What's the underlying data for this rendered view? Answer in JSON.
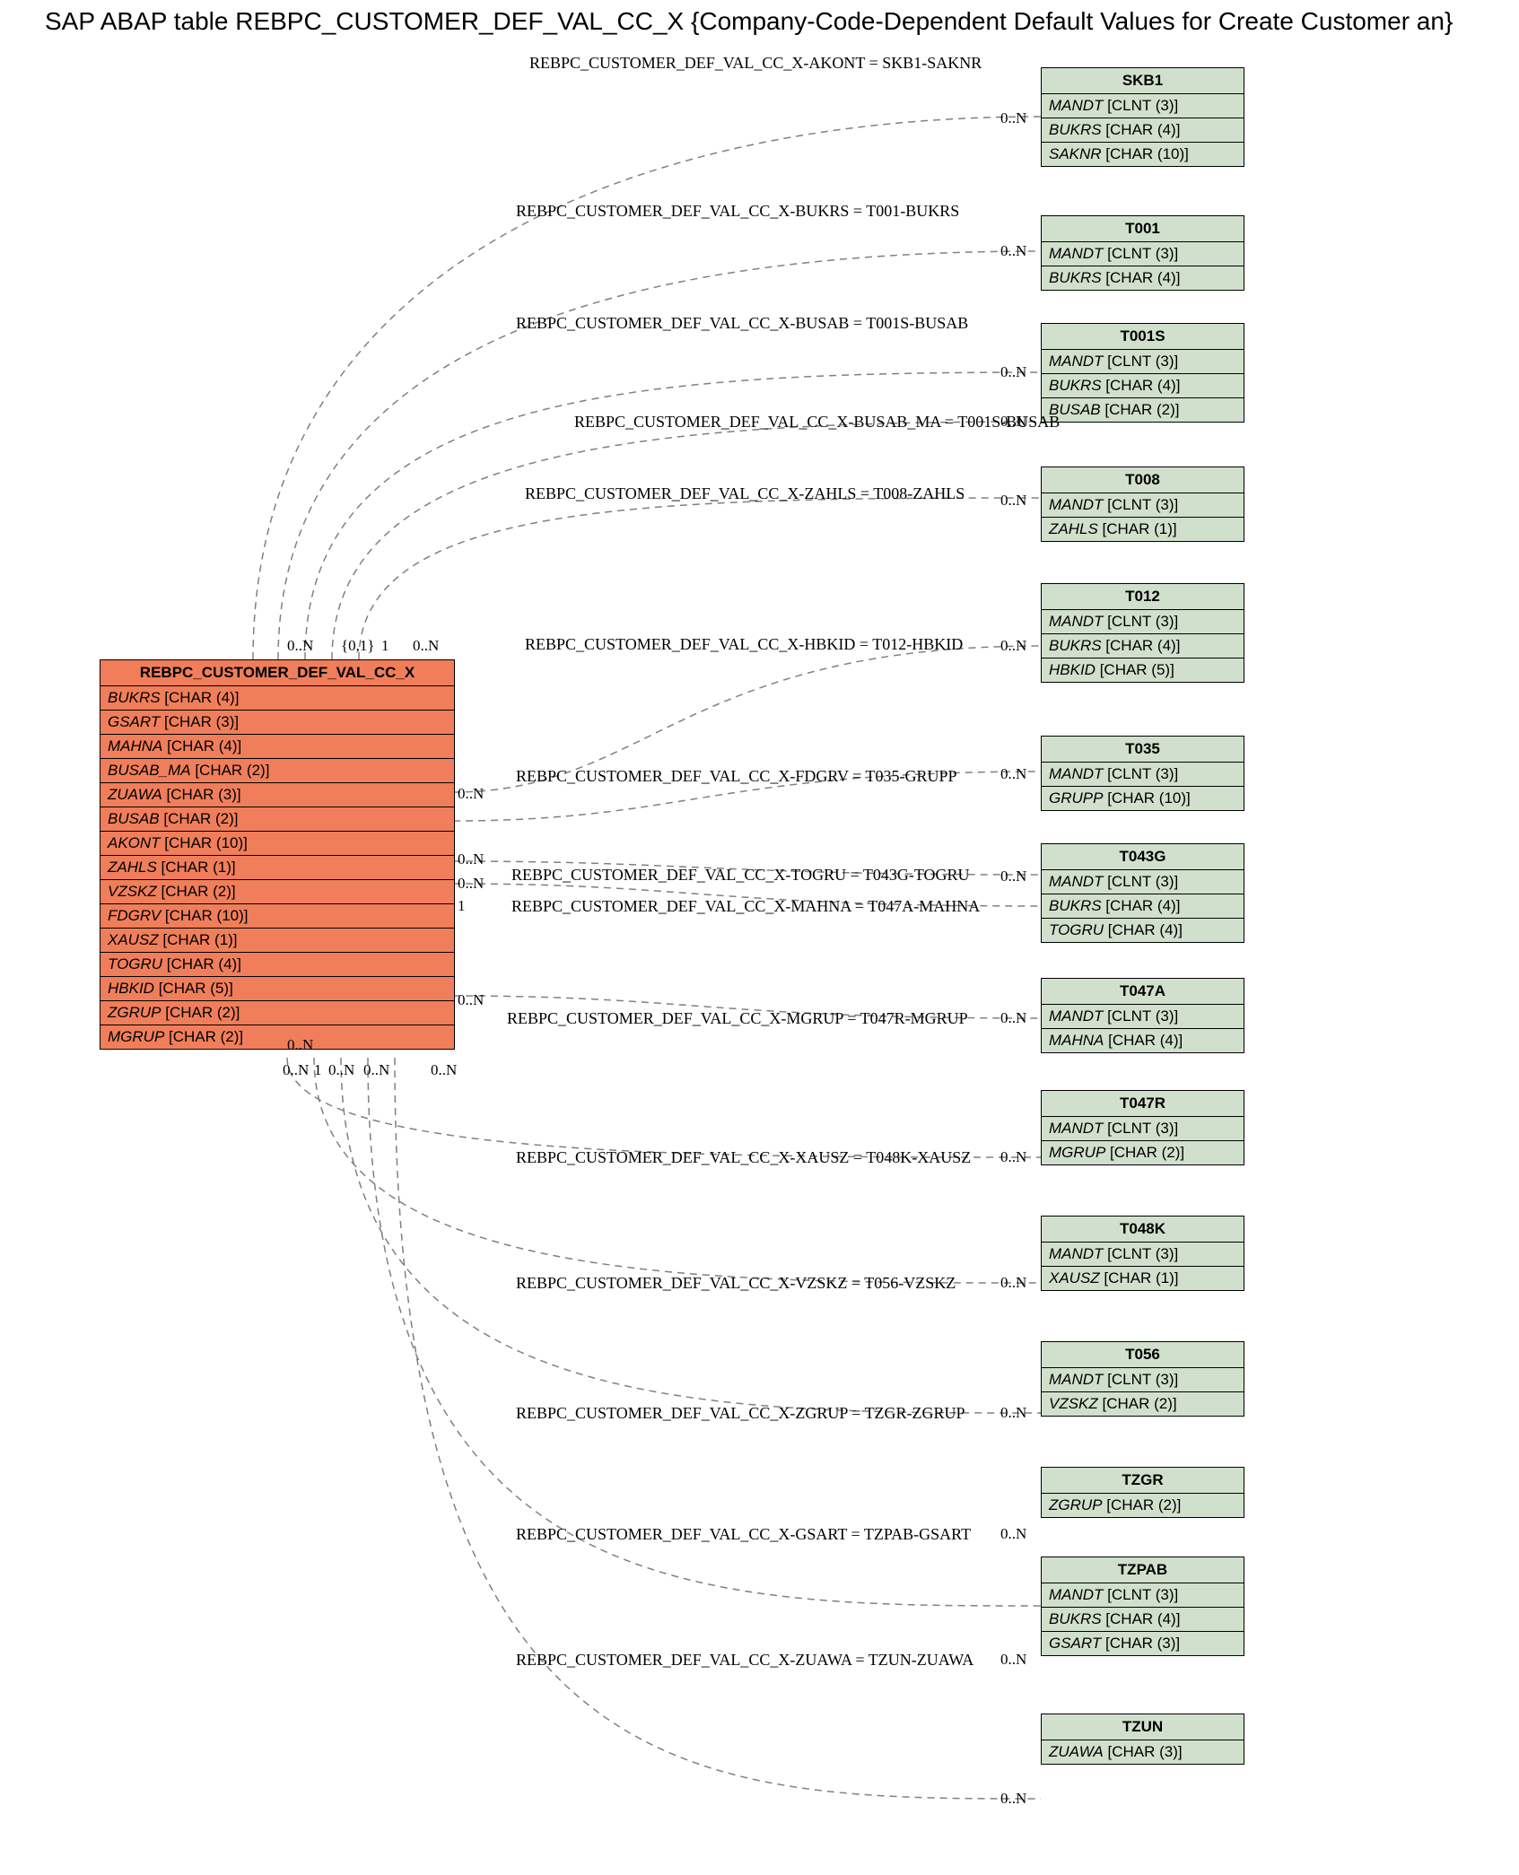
{
  "title": "SAP ABAP table REBPC_CUSTOMER_DEF_VAL_CC_X {Company-Code-Dependent Default Values for Create Customer an}",
  "main": {
    "name": "REBPC_CUSTOMER_DEF_VAL_CC_X",
    "fields": [
      {
        "f": "BUKRS",
        "t": "[CHAR (4)]"
      },
      {
        "f": "GSART",
        "t": "[CHAR (3)]"
      },
      {
        "f": "MAHNA",
        "t": "[CHAR (4)]"
      },
      {
        "f": "BUSAB_MA",
        "t": "[CHAR (2)]"
      },
      {
        "f": "ZUAWA",
        "t": "[CHAR (3)]"
      },
      {
        "f": "BUSAB",
        "t": "[CHAR (2)]"
      },
      {
        "f": "AKONT",
        "t": "[CHAR (10)]"
      },
      {
        "f": "ZAHLS",
        "t": "[CHAR (1)]"
      },
      {
        "f": "VZSKZ",
        "t": "[CHAR (2)]"
      },
      {
        "f": "FDGRV",
        "t": "[CHAR (10)]"
      },
      {
        "f": "XAUSZ",
        "t": "[CHAR (1)]"
      },
      {
        "f": "TOGRU",
        "t": "[CHAR (4)]"
      },
      {
        "f": "HBKID",
        "t": "[CHAR (5)]"
      },
      {
        "f": "ZGRUP",
        "t": "[CHAR (2)]"
      },
      {
        "f": "MGRUP",
        "t": "[CHAR (2)]"
      }
    ]
  },
  "refs": [
    {
      "name": "SKB1",
      "fields": [
        {
          "f": "MANDT",
          "t": "[CLNT (3)]"
        },
        {
          "f": "BUKRS",
          "t": "[CHAR (4)]"
        },
        {
          "f": "SAKNR",
          "t": "[CHAR (10)]"
        }
      ]
    },
    {
      "name": "T001",
      "fields": [
        {
          "f": "MANDT",
          "t": "[CLNT (3)]"
        },
        {
          "f": "BUKRS",
          "t": "[CHAR (4)]"
        }
      ]
    },
    {
      "name": "T001S",
      "fields": [
        {
          "f": "MANDT",
          "t": "[CLNT (3)]"
        },
        {
          "f": "BUKRS",
          "t": "[CHAR (4)]"
        },
        {
          "f": "BUSAB",
          "t": "[CHAR (2)]"
        }
      ]
    },
    {
      "name": "T008",
      "fields": [
        {
          "f": "MANDT",
          "t": "[CLNT (3)]"
        },
        {
          "f": "ZAHLS",
          "t": "[CHAR (1)]"
        }
      ]
    },
    {
      "name": "T012",
      "fields": [
        {
          "f": "MANDT",
          "t": "[CLNT (3)]"
        },
        {
          "f": "BUKRS",
          "t": "[CHAR (4)]"
        },
        {
          "f": "HBKID",
          "t": "[CHAR (5)]"
        }
      ]
    },
    {
      "name": "T035",
      "fields": [
        {
          "f": "MANDT",
          "t": "[CLNT (3)]"
        },
        {
          "f": "GRUPP",
          "t": "[CHAR (10)]"
        }
      ]
    },
    {
      "name": "T043G",
      "fields": [
        {
          "f": "MANDT",
          "t": "[CLNT (3)]"
        },
        {
          "f": "BUKRS",
          "t": "[CHAR (4)]"
        },
        {
          "f": "TOGRU",
          "t": "[CHAR (4)]"
        }
      ]
    },
    {
      "name": "T047A",
      "fields": [
        {
          "f": "MANDT",
          "t": "[CLNT (3)]"
        },
        {
          "f": "MAHNA",
          "t": "[CHAR (4)]"
        }
      ]
    },
    {
      "name": "T047R",
      "fields": [
        {
          "f": "MANDT",
          "t": "[CLNT (3)]"
        },
        {
          "f": "MGRUP",
          "t": "[CHAR (2)]"
        }
      ]
    },
    {
      "name": "T048K",
      "fields": [
        {
          "f": "MANDT",
          "t": "[CLNT (3)]"
        },
        {
          "f": "XAUSZ",
          "t": "[CHAR (1)]"
        }
      ]
    },
    {
      "name": "T056",
      "fields": [
        {
          "f": "MANDT",
          "t": "[CLNT (3)]"
        },
        {
          "f": "VZSKZ",
          "t": "[CHAR (2)]"
        }
      ]
    },
    {
      "name": "TZGR",
      "fields": [
        {
          "f": "ZGRUP",
          "t": "[CHAR (2)]"
        }
      ]
    },
    {
      "name": "TZPAB",
      "fields": [
        {
          "f": "MANDT",
          "t": "[CLNT (3)]"
        },
        {
          "f": "BUKRS",
          "t": "[CHAR (4)]"
        },
        {
          "f": "GSART",
          "t": "[CHAR (3)]"
        }
      ]
    },
    {
      "name": "TZUN",
      "fields": [
        {
          "f": "ZUAWA",
          "t": "[CHAR (3)]"
        }
      ]
    }
  ],
  "relations": [
    {
      "label": "REBPC_CUSTOMER_DEF_VAL_CC_X-AKONT = SKB1-SAKNR"
    },
    {
      "label": "REBPC_CUSTOMER_DEF_VAL_CC_X-BUKRS = T001-BUKRS"
    },
    {
      "label": "REBPC_CUSTOMER_DEF_VAL_CC_X-BUSAB = T001S-BUSAB"
    },
    {
      "label": "REBPC_CUSTOMER_DEF_VAL_CC_X-BUSAB_MA = T001S-BUSAB"
    },
    {
      "label": "REBPC_CUSTOMER_DEF_VAL_CC_X-ZAHLS = T008-ZAHLS"
    },
    {
      "label": "REBPC_CUSTOMER_DEF_VAL_CC_X-HBKID = T012-HBKID"
    },
    {
      "label": "REBPC_CUSTOMER_DEF_VAL_CC_X-FDGRV = T035-GRUPP"
    },
    {
      "label": "REBPC_CUSTOMER_DEF_VAL_CC_X-TOGRU = T043G-TOGRU"
    },
    {
      "label": "REBPC_CUSTOMER_DEF_VAL_CC_X-MAHNA = T047A-MAHNA"
    },
    {
      "label": "REBPC_CUSTOMER_DEF_VAL_CC_X-MGRUP = T047R-MGRUP"
    },
    {
      "label": "REBPC_CUSTOMER_DEF_VAL_CC_X-XAUSZ = T048K-XAUSZ"
    },
    {
      "label": "REBPC_CUSTOMER_DEF_VAL_CC_X-VZSKZ = T056-VZSKZ"
    },
    {
      "label": "REBPC_CUSTOMER_DEF_VAL_CC_X-ZGRUP = TZGR-ZGRUP"
    },
    {
      "label": "REBPC_CUSTOMER_DEF_VAL_CC_X-GSART = TZPAB-GSART"
    },
    {
      "label": "REBPC_CUSTOMER_DEF_VAL_CC_X-ZUAWA = TZUN-ZUAWA"
    }
  ],
  "cards": {
    "zeroN": "0..N",
    "one": "1",
    "topCluster": [
      "0..N",
      "{0,1}",
      "1",
      "0..N"
    ],
    "botCluster": [
      "0..N",
      "1",
      "0..N",
      "0..N",
      "0..N",
      "0..N"
    ]
  }
}
